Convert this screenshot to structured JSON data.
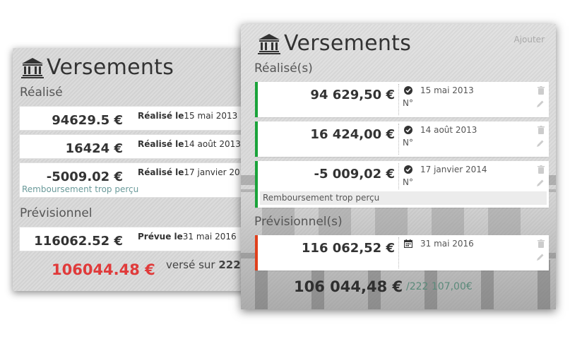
{
  "back_panel": {
    "title": "Versements",
    "section_realise": "Réalisé",
    "section_previsionnel": "Prévisionnel",
    "rows": [
      {
        "amount": "94629.5 €",
        "label": "Réalisé le",
        "date": "15 mai 2013",
        "note": ""
      },
      {
        "amount": "16424 €",
        "label": "Réalisé le",
        "date": "14 août 2013",
        "note": ""
      },
      {
        "amount": "-5009.02 €",
        "label": "Réalisé le",
        "date": "17 janvier 2014",
        "note": "Remboursement trop perçu"
      }
    ],
    "forecast_row": {
      "amount": "116062.52 €",
      "label": "Prévue le",
      "date": "31 mai 2016"
    },
    "total": "106044.48 €",
    "total_sub_prefix": "versé sur",
    "total_sub_value": "2221"
  },
  "front_panel": {
    "title": "Versements",
    "add_label": "Ajouter",
    "section_realise": "Réalisé(s)",
    "section_previsionnel": "Prévisionnel(s)",
    "rows": [
      {
        "amount": "94 629,50 €",
        "date": "15 mai 2013",
        "number_label": "N°",
        "note": ""
      },
      {
        "amount": "16 424,00 €",
        "date": "14 août 2013",
        "number_label": "N°",
        "note": ""
      },
      {
        "amount": "-5 009,02 €",
        "date": "17 janvier 2014",
        "number_label": "N°",
        "note": "Remboursement trop perçu"
      }
    ],
    "forecast_row": {
      "amount": "116 062,52 €",
      "date": "31 mai 2016"
    },
    "total": "106 044,48 €",
    "total_sub": "/222 107,00€"
  },
  "icons": {
    "title": "bank-icon",
    "realised": "check-circle-icon",
    "forecast": "calendar-icon",
    "delete": "trash-icon",
    "edit": "pencil-icon"
  },
  "colors": {
    "realised_accent": "#1aa33a",
    "forecast_accent": "#e0401c",
    "total_old": "#e03a3a",
    "total_sub_new": "#5a8a7a"
  }
}
